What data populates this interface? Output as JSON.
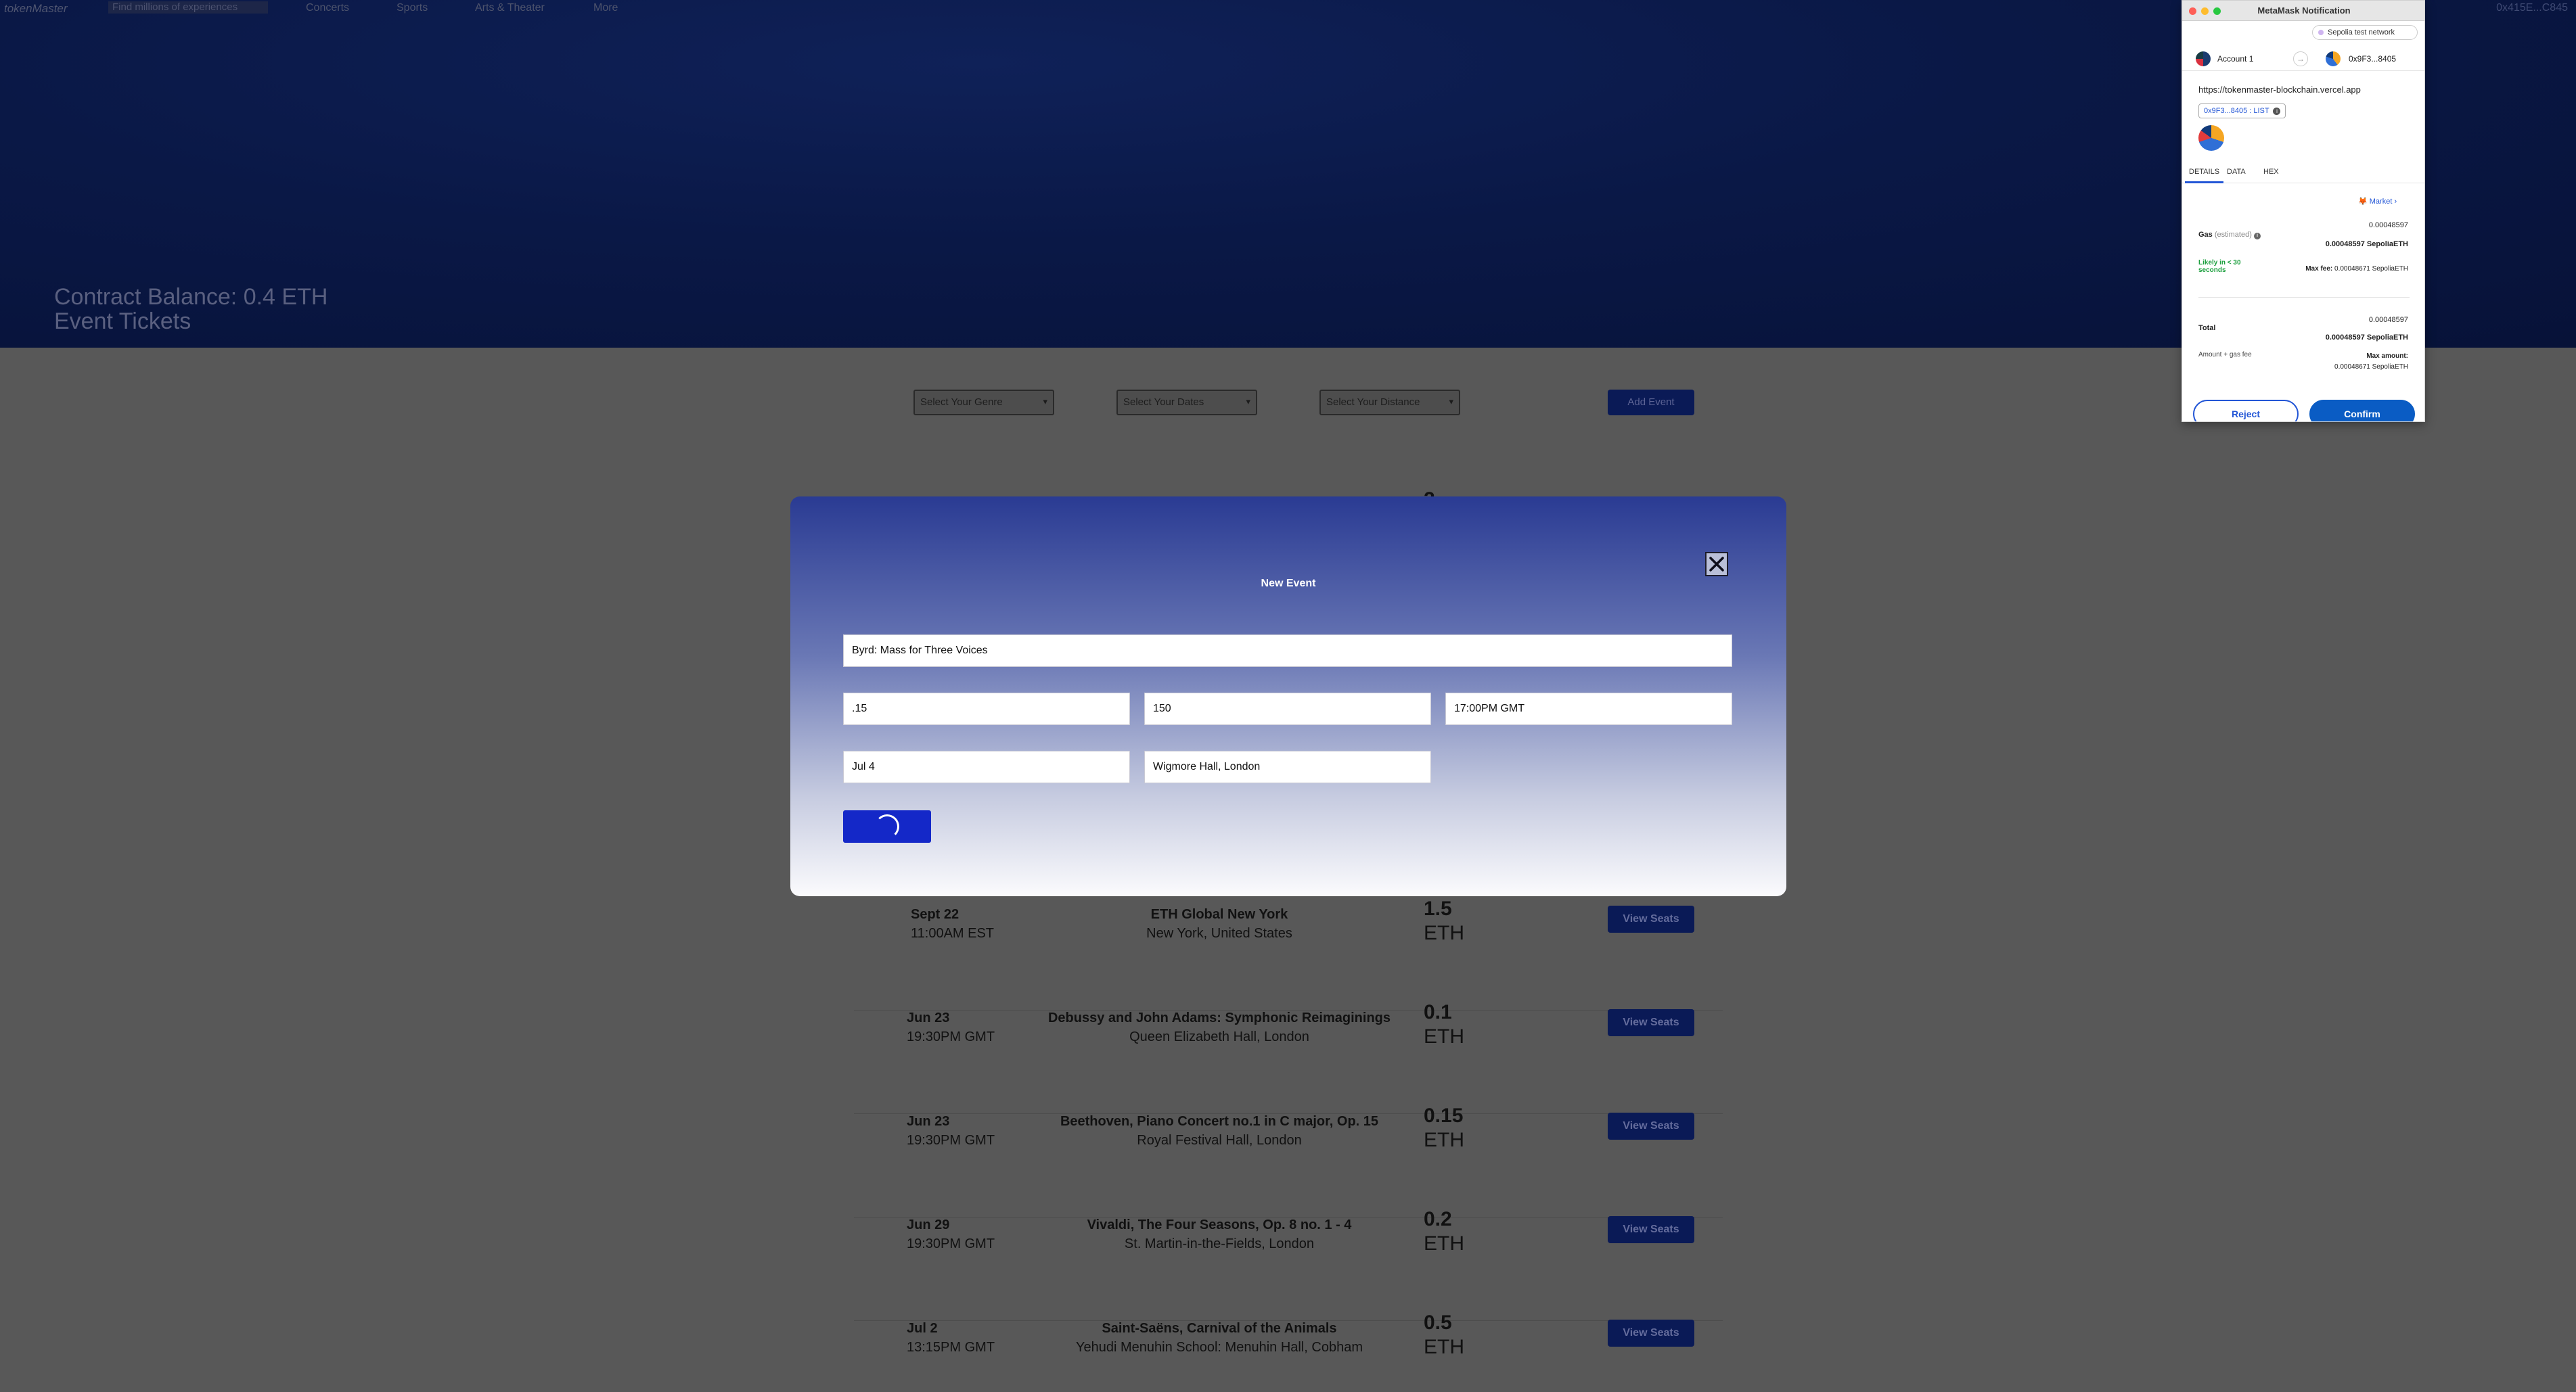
{
  "nav": {
    "logo": "tokenMaster",
    "search_placeholder": "Find millions of experiences",
    "links": [
      "Concerts",
      "Sports",
      "Arts & Theater",
      "More"
    ],
    "account": "0x415E...C845"
  },
  "hero": {
    "balance": "Contract Balance: 0.4 ETH",
    "title": "Event Tickets"
  },
  "filters": {
    "genre": "Select Your Genre",
    "dates": "Select Your Dates",
    "distance": "Select Your Distance",
    "add_event": "Add Event"
  },
  "events": [
    {
      "date": "Sept 22",
      "time": "11:00AM EST",
      "name": "ETH Global New York",
      "location": "New York, United States",
      "price": "1.5",
      "currency": "ETH",
      "button": "View Seats"
    },
    {
      "date": "Jun 23",
      "time": "19:30PM GMT",
      "name": "Debussy and John Adams: Symphonic Reimaginings",
      "location": "Queen Elizabeth Hall, London",
      "price": "0.1",
      "currency": "ETH",
      "button": "View Seats"
    },
    {
      "date": "Jun 23",
      "time": "19:30PM GMT",
      "name": "Beethoven, Piano Concert no.1 in C major, Op. 15",
      "location": "Royal Festival Hall, London",
      "price": "0.15",
      "currency": "ETH",
      "button": "View Seats"
    },
    {
      "date": "Jun 29",
      "time": "19:30PM GMT",
      "name": "Vivaldi, The Four Seasons, Op. 8 no. 1 - 4",
      "location": "St. Martin-in-the-Fields, London",
      "price": "0.2",
      "currency": "ETH",
      "button": "View Seats"
    },
    {
      "date": "Jul 2",
      "time": "13:15PM GMT",
      "name": "Saint-Saëns, Carnival of the Animals",
      "location": "Yehudi Menuhin School: Menuhin Hall, Cobham",
      "price": "0.5",
      "currency": "ETH",
      "button": "View Seats"
    }
  ],
  "hidden_row_price": "2",
  "modal": {
    "title": "New Event",
    "name": "Byrd: Mass for Three Voices",
    "cost": ".15",
    "tickets": "150",
    "time": "17:00PM GMT",
    "date": "Jul 4",
    "location": "Wigmore Hall, London"
  },
  "metamask": {
    "window_title": "MetaMask Notification",
    "network": "Sepolia test network",
    "account": "Account 1",
    "contract": "0x9F3...8405",
    "origin": "https://tokenmaster-blockchain.vercel.app",
    "method": "0x9F3...8405 : LIST",
    "tabs": [
      "DETAILS",
      "DATA",
      "HEX"
    ],
    "market": "Market",
    "gas_label": "Gas",
    "gas_estimated": "(estimated)",
    "gas_small": "0.00048597",
    "gas_bold": "0.00048597 SepoliaETH",
    "likely": "Likely in < 30 seconds",
    "max_fee_label": "Max fee:",
    "max_fee_value": "0.00048671 SepoliaETH",
    "total_label": "Total",
    "total_small": "0.00048597",
    "total_bold": "0.00048597 SepoliaETH",
    "amount_gas_fee": "Amount + gas fee",
    "max_amount_label": "Max amount:",
    "max_amount_value": "0.00048671 SepoliaETH",
    "reject": "Reject",
    "confirm": "Confirm"
  }
}
